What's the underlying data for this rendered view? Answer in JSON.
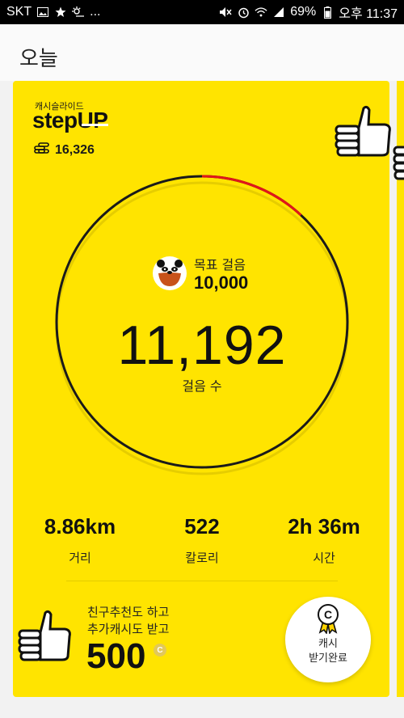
{
  "status_bar": {
    "carrier": "SKT",
    "battery": "69%",
    "time": "오후 11:37",
    "ellipsis": "..."
  },
  "header": {
    "title": "오늘"
  },
  "brand": {
    "small_label": "캐시슬라이드",
    "logo": "stepUP"
  },
  "coins": {
    "value": "16,326"
  },
  "goal": {
    "label": "목표 걸음",
    "value": "10,000"
  },
  "steps": {
    "value": "11,192",
    "label": "걸음 수",
    "progress_fraction": 1.119
  },
  "stats": [
    {
      "value": "8.86km",
      "label": "거리"
    },
    {
      "value": "522",
      "label": "칼로리"
    },
    {
      "value": "2h 36m",
      "label": "시간"
    }
  ],
  "promo": {
    "line1": "친구추천도 하고",
    "line2": "추가캐시도 받고",
    "amount": "500",
    "coin_symbol": "C"
  },
  "claim_button": {
    "line1": "캐시",
    "line2": "받기완료"
  },
  "colors": {
    "card": "#ffe400",
    "ring": "#1a1a1a",
    "over_goal": "#e0161a"
  }
}
